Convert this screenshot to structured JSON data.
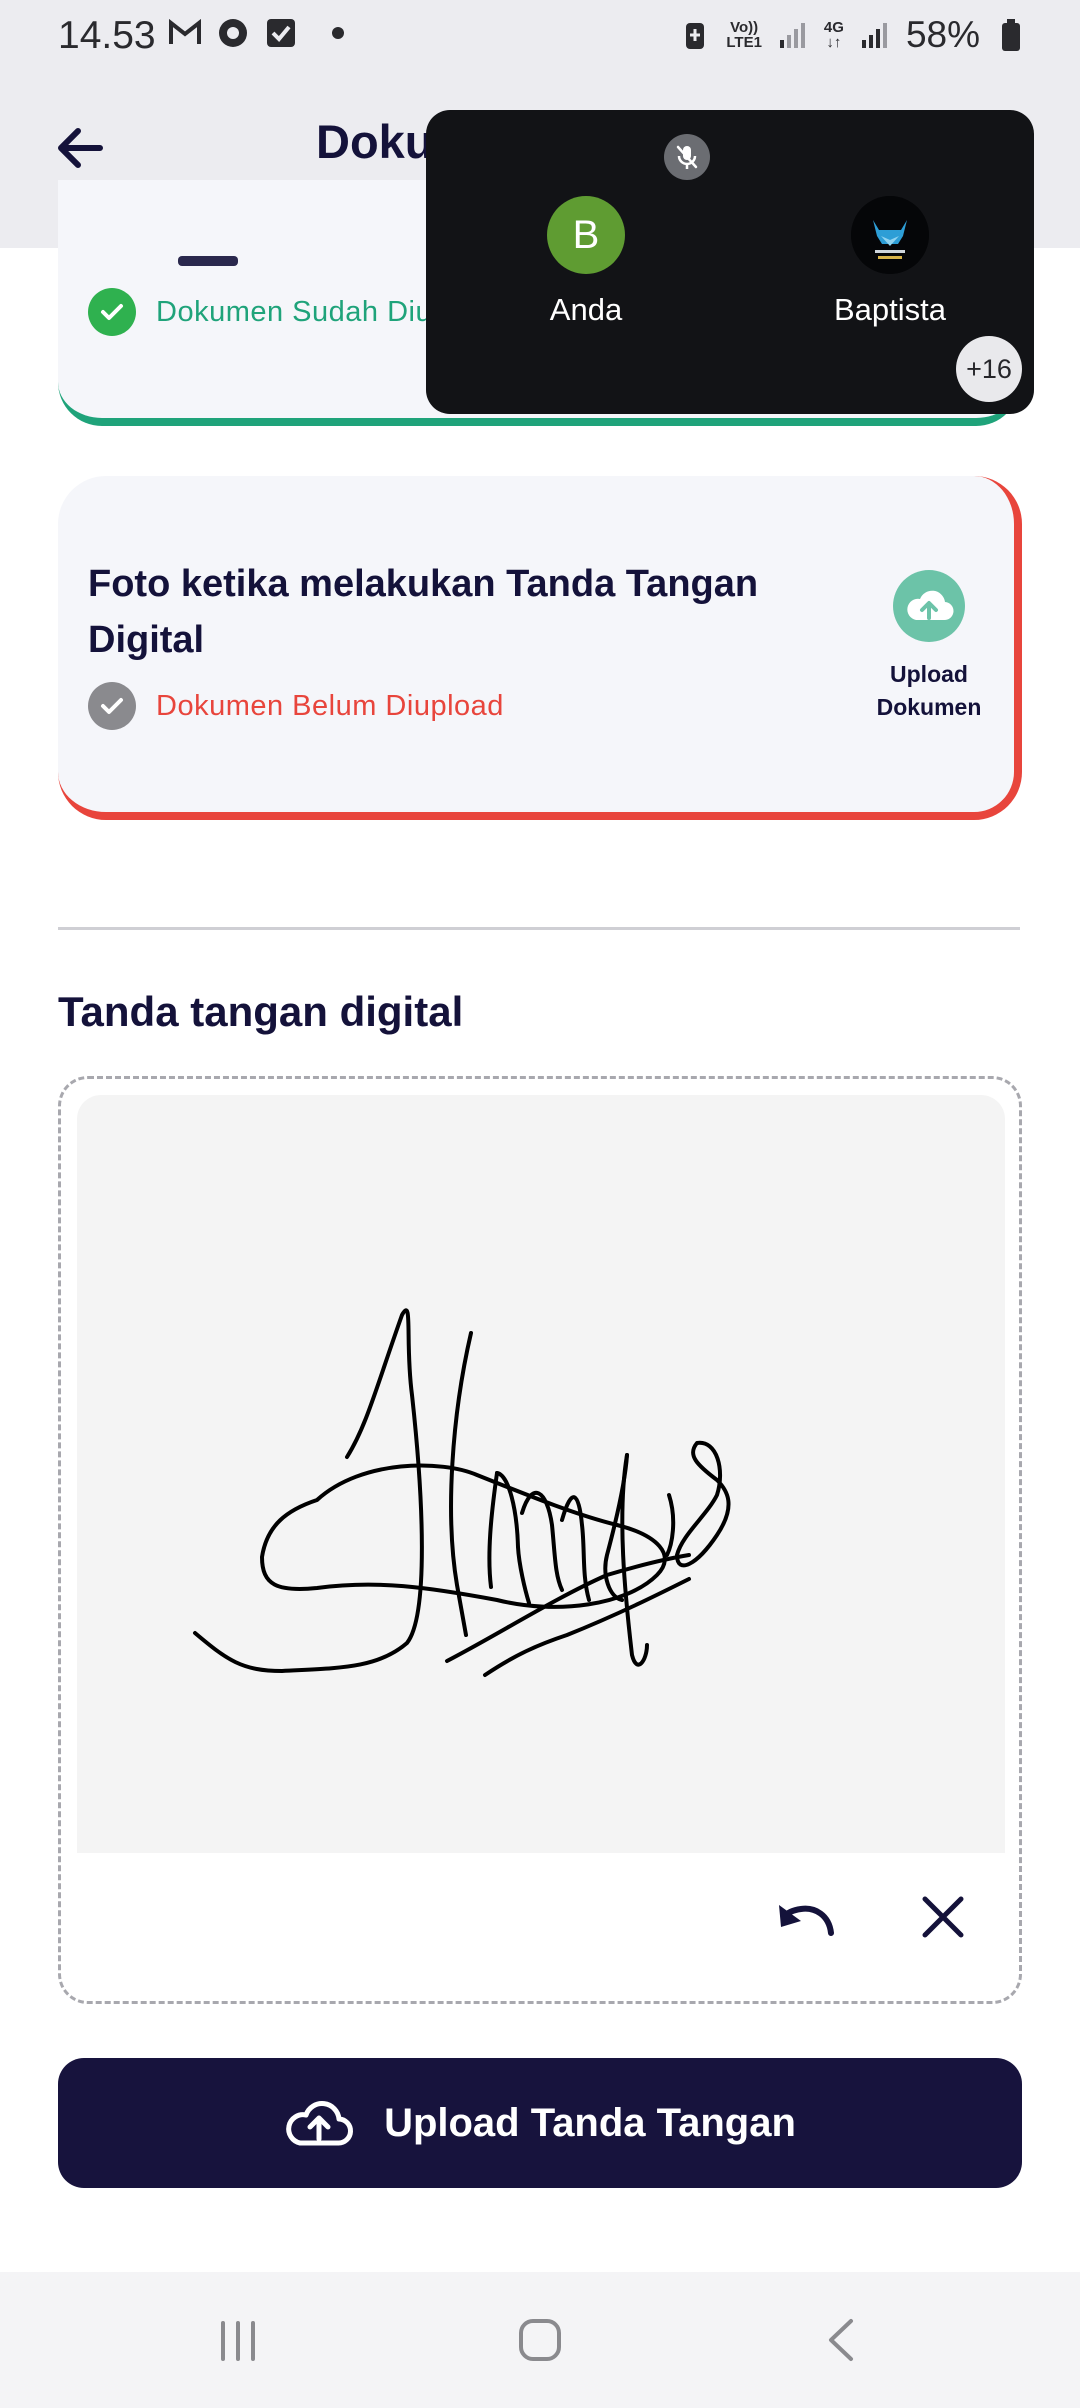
{
  "status_bar": {
    "time": "14.53",
    "network_top": "Vo)) ",
    "network_bottom": "LTE1",
    "data_top": "4G",
    "data_bottom": "↓↑",
    "battery": "58%"
  },
  "header": {
    "title": "Dokumen",
    "back_icon": "arrow-left-icon"
  },
  "documents": [
    {
      "status": "Dokumen Sudah Diupload",
      "status_color": "#1fa37a",
      "border_color": "#1fa37a"
    },
    {
      "title": "Foto ketika melakukan Tanda Tangan Digital",
      "status": "Dokumen Belum Diupload",
      "status_color": "#e8453c",
      "border_color": "#e8453c",
      "action_label": "Upload Dokumen",
      "action_icon": "cloud-upload-icon"
    }
  ],
  "signature": {
    "heading": "Tanda tangan digital",
    "undo_icon": "undo-icon",
    "clear_icon": "close-icon",
    "upload_label": "Upload Tanda Tangan",
    "upload_icon": "cloud-upload-icon"
  },
  "call_overlay": {
    "participants": [
      {
        "initial": "B",
        "name": "Anda"
      },
      {
        "name": "Baptista"
      }
    ],
    "more_count": "+16"
  },
  "colors": {
    "primary": "#17133d",
    "success": "#1fa37a",
    "danger": "#e8453c",
    "upload_icon_bg": "#6cc3a8"
  }
}
